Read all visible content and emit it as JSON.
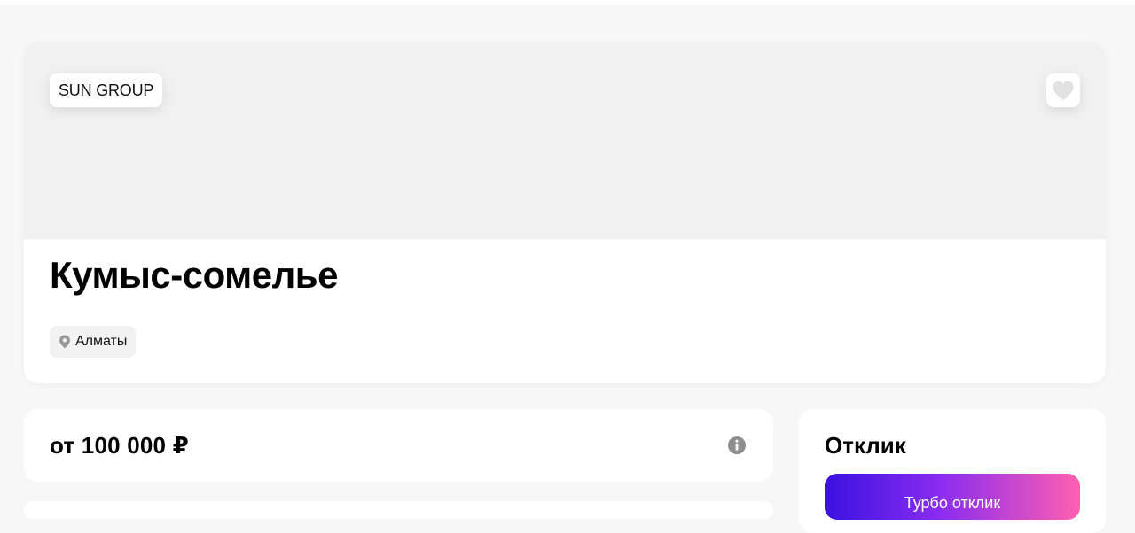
{
  "company": {
    "name": "SUN GROUP"
  },
  "vacancy": {
    "title": "Кумыс-сомелье",
    "location": "Алматы"
  },
  "salary": {
    "text": "от 100 000 ₽"
  },
  "response": {
    "title": "Отклик",
    "turbo_label": "Турбо отклик"
  },
  "icons": {
    "favorite": "heart-icon",
    "location": "location-pin-icon",
    "info": "info-icon"
  },
  "colors": {
    "turbo_gradient_start": "#3a12e0",
    "turbo_gradient_end": "#ff5fb0",
    "banner_bg": "#f1f1f1"
  }
}
